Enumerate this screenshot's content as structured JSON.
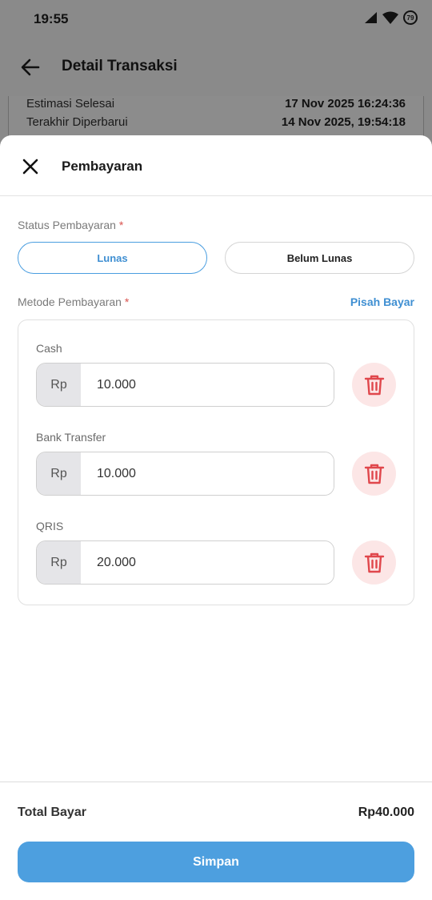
{
  "status_bar": {
    "time": "19:55",
    "battery": "79"
  },
  "background": {
    "title": "Detail Transaksi",
    "rows": [
      {
        "label": "Estimasi Selesai",
        "value": "17 Nov 2025 16:24:36"
      },
      {
        "label": "Terakhir Diperbarui",
        "value": "14 Nov 2025, 19:54:18"
      }
    ]
  },
  "sheet": {
    "title": "Pembayaran",
    "status": {
      "label": "Status Pembayaran",
      "required_mark": "*",
      "options": [
        "Lunas",
        "Belum Lunas"
      ],
      "selected": "Lunas"
    },
    "method": {
      "label": "Metode Pembayaran",
      "required_mark": "*",
      "split_link": "Pisah Bayar",
      "items": [
        {
          "name": "Cash",
          "prefix": "Rp",
          "amount": "10.000"
        },
        {
          "name": "Bank Transfer",
          "prefix": "Rp",
          "amount": "10.000"
        },
        {
          "name": "QRIS",
          "prefix": "Rp",
          "amount": "20.000"
        }
      ]
    },
    "total": {
      "label": "Total Bayar",
      "value": "Rp40.000"
    },
    "save_label": "Simpan"
  },
  "colors": {
    "accent": "#4d9fdf",
    "danger": "#e0474c",
    "danger_bg": "#fce6e6"
  }
}
